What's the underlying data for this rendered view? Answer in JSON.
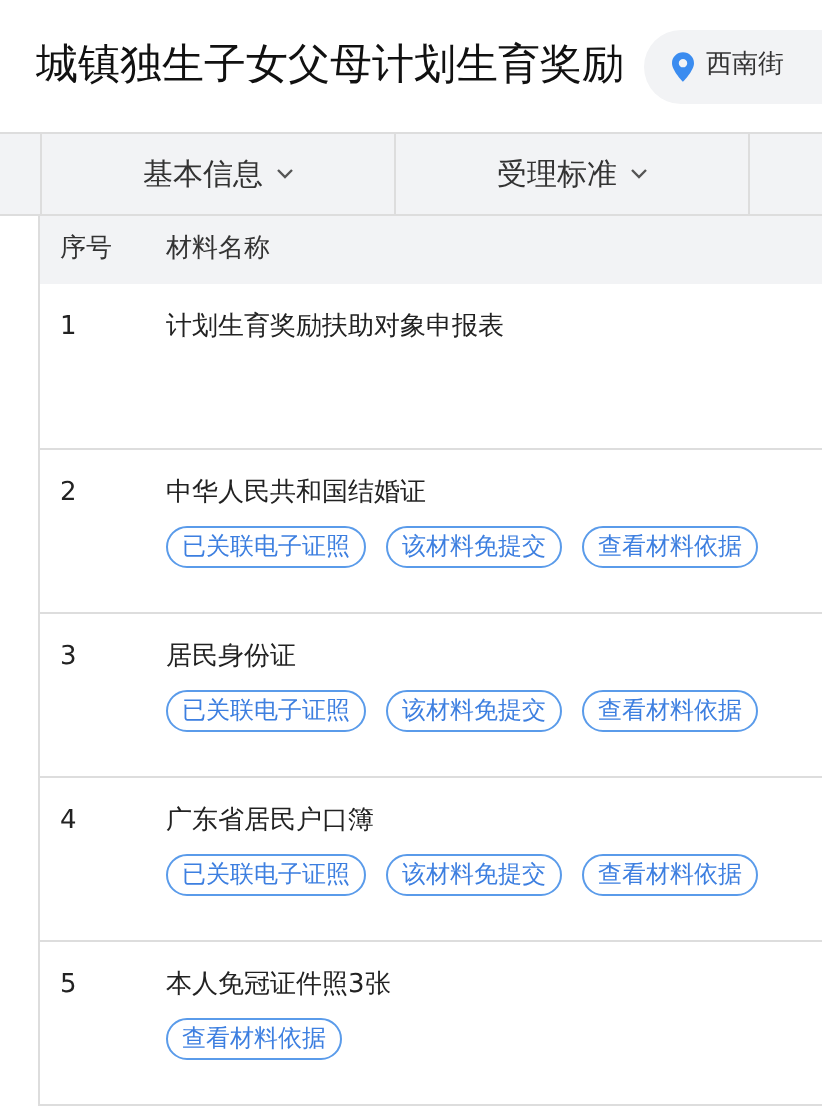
{
  "title": "城镇独生子女父母计划生育奖励",
  "location": {
    "label": "西南街"
  },
  "tabs": [
    {
      "label": "基本信息"
    },
    {
      "label": "受理标准"
    }
  ],
  "table": {
    "columns": [
      "序号",
      "材料名称"
    ],
    "rows": [
      {
        "index": "1",
        "name": "计划生育奖励扶助对象申报表",
        "tags": []
      },
      {
        "index": "2",
        "name": "中华人民共和国结婚证",
        "tags": [
          "已关联电子证照",
          "该材料免提交",
          "查看材料依据"
        ]
      },
      {
        "index": "3",
        "name": "居民身份证",
        "tags": [
          "已关联电子证照",
          "该材料免提交",
          "查看材料依据"
        ]
      },
      {
        "index": "4",
        "name": "广东省居民户口簿",
        "tags": [
          "已关联电子证照",
          "该材料免提交",
          "查看材料依据"
        ]
      },
      {
        "index": "5",
        "name": "本人免冠证件照3张",
        "tags": [
          "查看材料依据"
        ]
      }
    ]
  }
}
